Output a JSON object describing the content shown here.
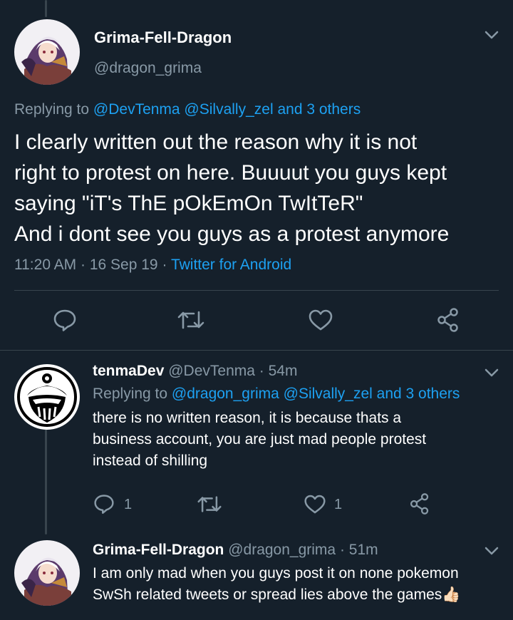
{
  "colors": {
    "background": "#15202b",
    "accent": "#1da1f2",
    "muted": "#8899a6",
    "divider": "#38444d"
  },
  "main_tweet": {
    "display_name": "Grima-Fell-Dragon",
    "handle": "@dragon_grima",
    "replying_prefix": "Replying to",
    "replying_users": "@DevTenma @Silvally_zel and 3 others",
    "body_lines": [
      "I clearly written out the reason why it is not",
      "right to protest on here. Buuuut you guys kept",
      "saying \"iT's ThE pOkEmOn TwItTeR\"",
      "And i dont see you guys as a protest anymore"
    ],
    "time": "11:20 AM",
    "date": "16 Sep 19",
    "source": "Twitter for Android",
    "separator": "·",
    "icons": [
      "reply-icon",
      "retweet-icon",
      "like-icon",
      "share-icon"
    ]
  },
  "replies": [
    {
      "display_name": "tenmaDev",
      "handle": "@DevTenma",
      "separator": "·",
      "time": "54m",
      "replying_prefix": "Replying to",
      "replying_users": "@dragon_grima @Silvally_zel and 3 others",
      "body_lines": [
        "there is no written reason, it is because thats a",
        "business account, you are just mad people protest",
        "instead of shilling"
      ],
      "reply_count": "1",
      "like_count": "1"
    },
    {
      "display_name": "Grima-Fell-Dragon",
      "handle": "@dragon_grima",
      "separator": "·",
      "time": "51m",
      "body_lines": [
        "I am only mad when you guys post it on none pokemon",
        "SwSh related tweets or spread lies above the games"
      ],
      "emoji": "👍🏻"
    }
  ]
}
